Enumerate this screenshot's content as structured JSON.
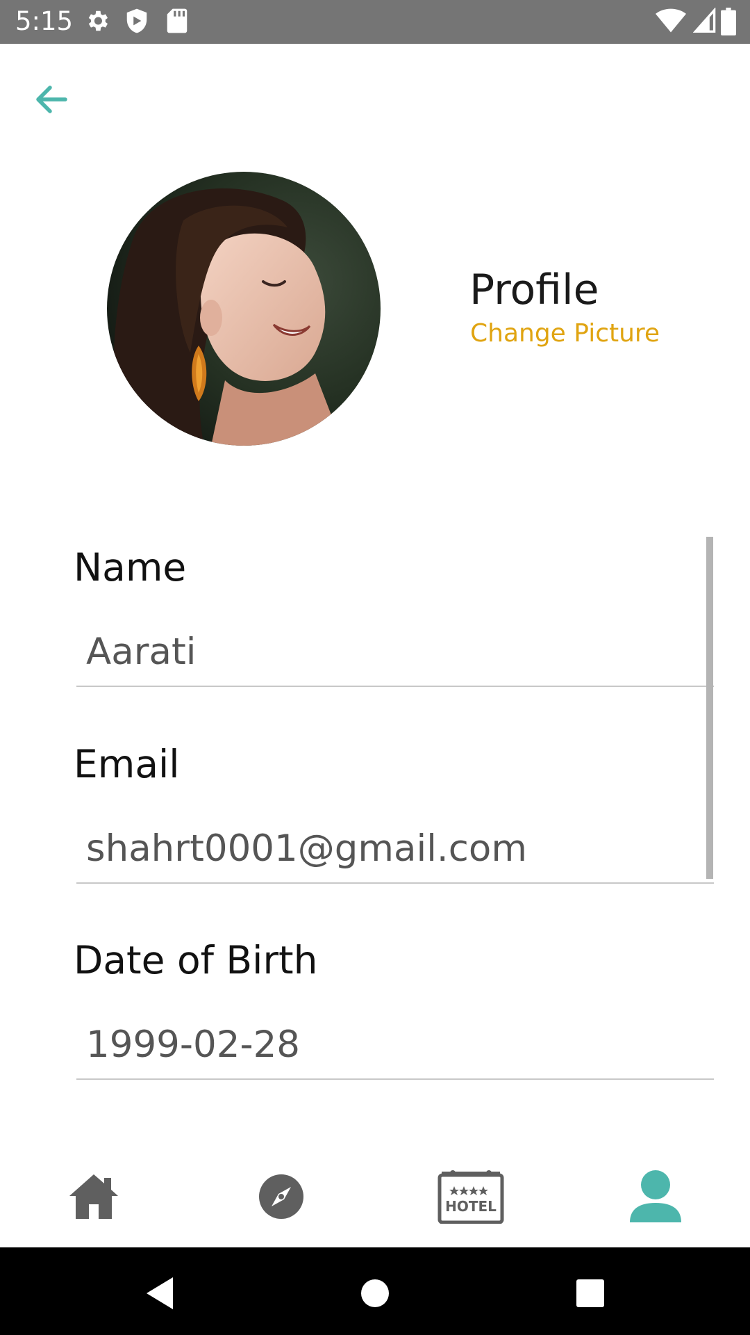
{
  "status_bar": {
    "time": "5:15",
    "left_icons": [
      "settings-icon",
      "shield-icon",
      "sd-card-icon"
    ],
    "right_icons": [
      "wifi-icon",
      "cell-signal-icon",
      "battery-icon"
    ]
  },
  "header": {
    "back_icon": "arrow-left-icon"
  },
  "profile": {
    "title": "Profile",
    "change_picture_label": "Change Picture"
  },
  "form": {
    "name_label": "Name",
    "name_value": "Aarati",
    "email_label": "Email",
    "email_value": "shahrt0001@gmail.com",
    "dob_label": "Date of Birth",
    "dob_value": "1999-02-28"
  },
  "bottom_nav": {
    "items": [
      {
        "icon": "home-icon",
        "active": false
      },
      {
        "icon": "compass-icon",
        "active": false
      },
      {
        "icon": "hotel-icon",
        "label": "HOTEL",
        "active": false
      },
      {
        "icon": "user-icon",
        "active": true
      }
    ]
  },
  "system_nav": {
    "buttons": [
      "back-triangle-icon",
      "home-circle-icon",
      "recents-square-icon"
    ]
  },
  "colors": {
    "accent": "#4db6ac",
    "link": "#e0a411",
    "status_bar": "#757575",
    "nav_inactive": "#5f5f5f"
  }
}
